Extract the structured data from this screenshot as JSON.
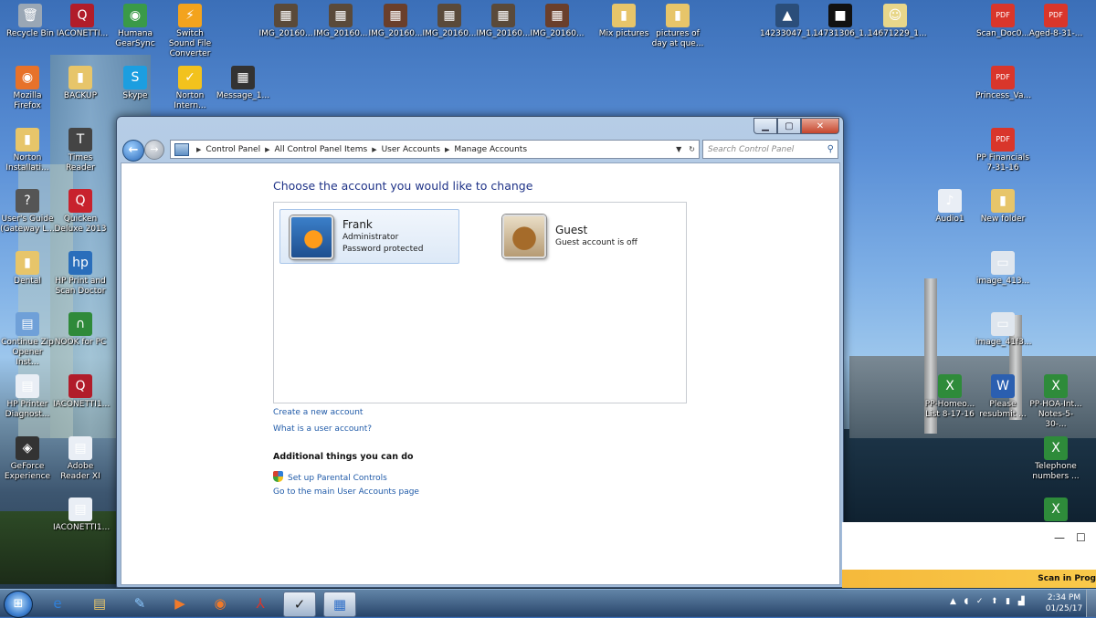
{
  "desktop": {
    "top_row": [
      {
        "label": "Recycle Bin",
        "icon": "recycle-bin-icon",
        "glyph": "🗑",
        "color": "#9aa7b5"
      },
      {
        "label": "IACONETTI...",
        "icon": "quicken-doc-icon",
        "glyph": "Q",
        "color": "#b11c2a"
      },
      {
        "label": "Humana GearSync",
        "icon": "humana-icon",
        "glyph": "◉",
        "color": "#3a9a48"
      },
      {
        "label": "Switch Sound File Converter",
        "icon": "switch-icon",
        "glyph": "⚡",
        "color": "#f3a31d"
      },
      {
        "label": "IMG_20160...",
        "icon": "image-icon",
        "glyph": "▦",
        "color": "#5a4a3a"
      },
      {
        "label": "IMG_20160...",
        "icon": "image-icon",
        "glyph": "▦",
        "color": "#5a4a3a"
      },
      {
        "label": "IMG_20160...",
        "icon": "image-icon",
        "glyph": "▦",
        "color": "#6a3f2c"
      },
      {
        "label": "IMG_20160...",
        "icon": "image-icon",
        "glyph": "▦",
        "color": "#5a4a3a"
      },
      {
        "label": "IMG_20160...",
        "icon": "image-icon",
        "glyph": "▦",
        "color": "#5a4a3a"
      },
      {
        "label": "IMG_20160...",
        "icon": "image-icon",
        "glyph": "▦",
        "color": "#6a3f2c"
      },
      {
        "label": "Mix pictures",
        "icon": "folder-icon",
        "glyph": "▮",
        "color": "#e7c56a"
      },
      {
        "label": "pictures of day at que...",
        "icon": "folder-icon",
        "glyph": "▮",
        "color": "#e7c56a"
      },
      {
        "label": "14233047_1...",
        "icon": "image-icon",
        "glyph": "▲",
        "color": "#2b4e7a"
      },
      {
        "label": "14731306_1...",
        "icon": "image-icon",
        "glyph": "■",
        "color": "#111111"
      },
      {
        "label": "14671229_1...",
        "icon": "image-icon",
        "glyph": "☺",
        "color": "#e8d78a"
      },
      {
        "label": "Scan_Doc0...",
        "icon": "pdf-icon",
        "glyph": "PDF",
        "color": "#d9362b"
      },
      {
        "label": "Aged-8-31-...",
        "icon": "pdf-icon",
        "glyph": "PDF",
        "color": "#d9362b"
      }
    ],
    "left_col": [
      {
        "label": "Mozilla Firefox",
        "icon": "firefox-icon",
        "glyph": "◉",
        "color": "#e7722a"
      },
      {
        "label": "BACKUP",
        "icon": "folder-icon",
        "glyph": "▮",
        "color": "#e7c56a"
      },
      {
        "label": "Skype",
        "icon": "skype-icon",
        "glyph": "S",
        "color": "#1c9ee0"
      },
      {
        "label": "Norton Intern...",
        "icon": "norton-icon",
        "glyph": "✓",
        "color": "#f2c21d"
      },
      {
        "label": "Message_1...",
        "icon": "video-icon",
        "glyph": "▦",
        "color": "#333333"
      },
      {
        "label": "Norton Installati...",
        "icon": "norton-installer-icon",
        "glyph": "▮",
        "color": "#e7c56a"
      },
      {
        "label": "Times Reader",
        "icon": "times-reader-icon",
        "glyph": "T",
        "color": "#444444"
      },
      {
        "label": "User's Guide (Gateway L...",
        "icon": "help-icon",
        "glyph": "?",
        "color": "#555555"
      },
      {
        "label": "Quicken Deluxe 2013",
        "icon": "quicken-icon",
        "glyph": "Q",
        "color": "#c8222d"
      },
      {
        "label": "Dental",
        "icon": "folder-icon",
        "glyph": "▮",
        "color": "#e7c56a"
      },
      {
        "label": "HP Print and Scan Doctor",
        "icon": "hp-icon",
        "glyph": "hp",
        "color": "#2a6ebb"
      },
      {
        "label": "Continue Zip Opener Inst...",
        "icon": "installer-icon",
        "glyph": "▤",
        "color": "#6fa0d8"
      },
      {
        "label": "NOOK for PC",
        "icon": "nook-icon",
        "glyph": "∩",
        "color": "#2f8a3a"
      },
      {
        "label": "HP Printer Diagnost...",
        "icon": "doc-icon",
        "glyph": "▤",
        "color": "#e9eef5"
      },
      {
        "label": "IACONETTI1...",
        "icon": "quicken-doc-icon",
        "glyph": "Q",
        "color": "#b11c2a"
      },
      {
        "label": "GeForce Experience",
        "icon": "geforce-icon",
        "glyph": "◈",
        "color": "#333333"
      },
      {
        "label": "Adobe Reader XI",
        "icon": "adobe-icon",
        "glyph": "▤",
        "color": "#e9eef5"
      },
      {
        "label": "IACONETTI1...",
        "icon": "doc-icon",
        "glyph": "▤",
        "color": "#e9eef5"
      }
    ],
    "right_col": [
      {
        "label": "Princess_Va...",
        "icon": "pdf-icon",
        "glyph": "PDF",
        "color": "#d9362b"
      },
      {
        "label": "PP Financials 7-31-16",
        "icon": "pdf-icon",
        "glyph": "PDF",
        "color": "#d9362b"
      },
      {
        "label": "Audio1",
        "icon": "audio-icon",
        "glyph": "♪",
        "color": "#e9eef5"
      },
      {
        "label": "New folder",
        "icon": "folder-icon",
        "glyph": "▮",
        "color": "#e7c56a"
      },
      {
        "label": "image_413...",
        "icon": "image-icon",
        "glyph": "▭",
        "color": "#dfe6ee"
      },
      {
        "label": "image_41f3...",
        "icon": "image-icon",
        "glyph": "▭",
        "color": "#dfe6ee"
      },
      {
        "label": "PP-Homeo... List 8-17-16",
        "icon": "excel-icon",
        "glyph": "X",
        "color": "#2e8b3a"
      },
      {
        "label": "Please resubmit ...",
        "icon": "word-icon",
        "glyph": "W",
        "color": "#2b5fb0"
      },
      {
        "label": "PP-HOA-Int... Notes-5-30-...",
        "icon": "excel-icon",
        "glyph": "X",
        "color": "#2e8b3a"
      },
      {
        "label": "Telephone numbers ...",
        "icon": "excel-icon",
        "glyph": "X",
        "color": "#2e8b3a"
      },
      {
        "label": "",
        "icon": "excel-icon",
        "glyph": "X",
        "color": "#2e8b3a"
      }
    ]
  },
  "window": {
    "breadcrumbs": [
      "Control Panel",
      "All Control Panel Items",
      "User Accounts",
      "Manage Accounts"
    ],
    "search_placeholder": "Search Control Panel",
    "heading": "Choose the account you would like to change",
    "accounts": [
      {
        "name": "Frank",
        "lines": [
          "Administrator",
          "Password protected"
        ]
      },
      {
        "name": "Guest",
        "lines": [
          "Guest account is off"
        ]
      }
    ],
    "links": {
      "create": "Create a new account",
      "what_is": "What is a user account?",
      "additional_heading": "Additional things you can do",
      "parental": "Set up Parental Controls",
      "main_page": "Go to the main User Accounts page"
    }
  },
  "background_window": {
    "banner": "Scan in Prog"
  },
  "taskbar": {
    "clock_time": "2:34 PM",
    "clock_date": "01/25/17"
  }
}
